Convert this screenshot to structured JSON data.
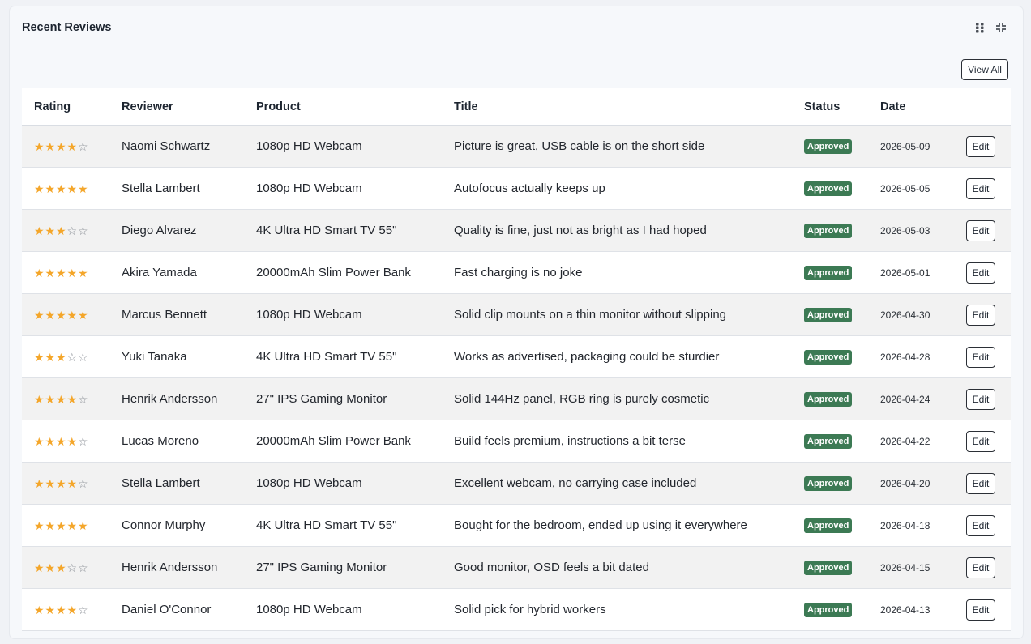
{
  "widget": {
    "title": "Recent Reviews",
    "view_all_label": "View All",
    "icons": [
      "grid-drag-icon",
      "collapse-icon"
    ]
  },
  "table": {
    "headers": [
      "Rating",
      "Reviewer",
      "Product",
      "Title",
      "Status",
      "Date",
      ""
    ],
    "edit_label": "Edit",
    "rows": [
      {
        "rating": 4,
        "reviewer": "Naomi Schwartz",
        "product": "1080p HD Webcam",
        "title": "Picture is great, USB cable is on the short side",
        "status": "Approved",
        "date": "2026-05-09"
      },
      {
        "rating": 5,
        "reviewer": "Stella Lambert",
        "product": "1080p HD Webcam",
        "title": "Autofocus actually keeps up",
        "status": "Approved",
        "date": "2026-05-05"
      },
      {
        "rating": 3,
        "reviewer": "Diego Alvarez",
        "product": "4K Ultra HD Smart TV 55\"",
        "title": "Quality is fine, just not as bright as I had hoped",
        "status": "Approved",
        "date": "2026-05-03"
      },
      {
        "rating": 5,
        "reviewer": "Akira Yamada",
        "product": "20000mAh Slim Power Bank",
        "title": "Fast charging is no joke",
        "status": "Approved",
        "date": "2026-05-01"
      },
      {
        "rating": 5,
        "reviewer": "Marcus Bennett",
        "product": "1080p HD Webcam",
        "title": "Solid clip mounts on a thin monitor without slipping",
        "status": "Approved",
        "date": "2026-04-30"
      },
      {
        "rating": 3,
        "reviewer": "Yuki Tanaka",
        "product": "4K Ultra HD Smart TV 55\"",
        "title": "Works as advertised, packaging could be sturdier",
        "status": "Approved",
        "date": "2026-04-28"
      },
      {
        "rating": 4,
        "reviewer": "Henrik Andersson",
        "product": "27\" IPS Gaming Monitor",
        "title": "Solid 144Hz panel, RGB ring is purely cosmetic",
        "status": "Approved",
        "date": "2026-04-24"
      },
      {
        "rating": 4,
        "reviewer": "Lucas Moreno",
        "product": "20000mAh Slim Power Bank",
        "title": "Build feels premium, instructions a bit terse",
        "status": "Approved",
        "date": "2026-04-22"
      },
      {
        "rating": 4,
        "reviewer": "Stella Lambert",
        "product": "1080p HD Webcam",
        "title": "Excellent webcam, no carrying case included",
        "status": "Approved",
        "date": "2026-04-20"
      },
      {
        "rating": 5,
        "reviewer": "Connor Murphy",
        "product": "4K Ultra HD Smart TV 55\"",
        "title": "Bought for the bedroom, ended up using it everywhere",
        "status": "Approved",
        "date": "2026-04-18"
      },
      {
        "rating": 3,
        "reviewer": "Henrik Andersson",
        "product": "27\" IPS Gaming Monitor",
        "title": "Good monitor, OSD feels a bit dated",
        "status": "Approved",
        "date": "2026-04-15"
      },
      {
        "rating": 4,
        "reviewer": "Daniel O'Connor",
        "product": "1080p HD Webcam",
        "title": "Solid pick for hybrid workers",
        "status": "Approved",
        "date": "2026-04-13"
      }
    ]
  },
  "colors": {
    "star_full": "#f4a62a",
    "star_empty": "#8a8f96",
    "badge_approved": "#3c7a54"
  }
}
